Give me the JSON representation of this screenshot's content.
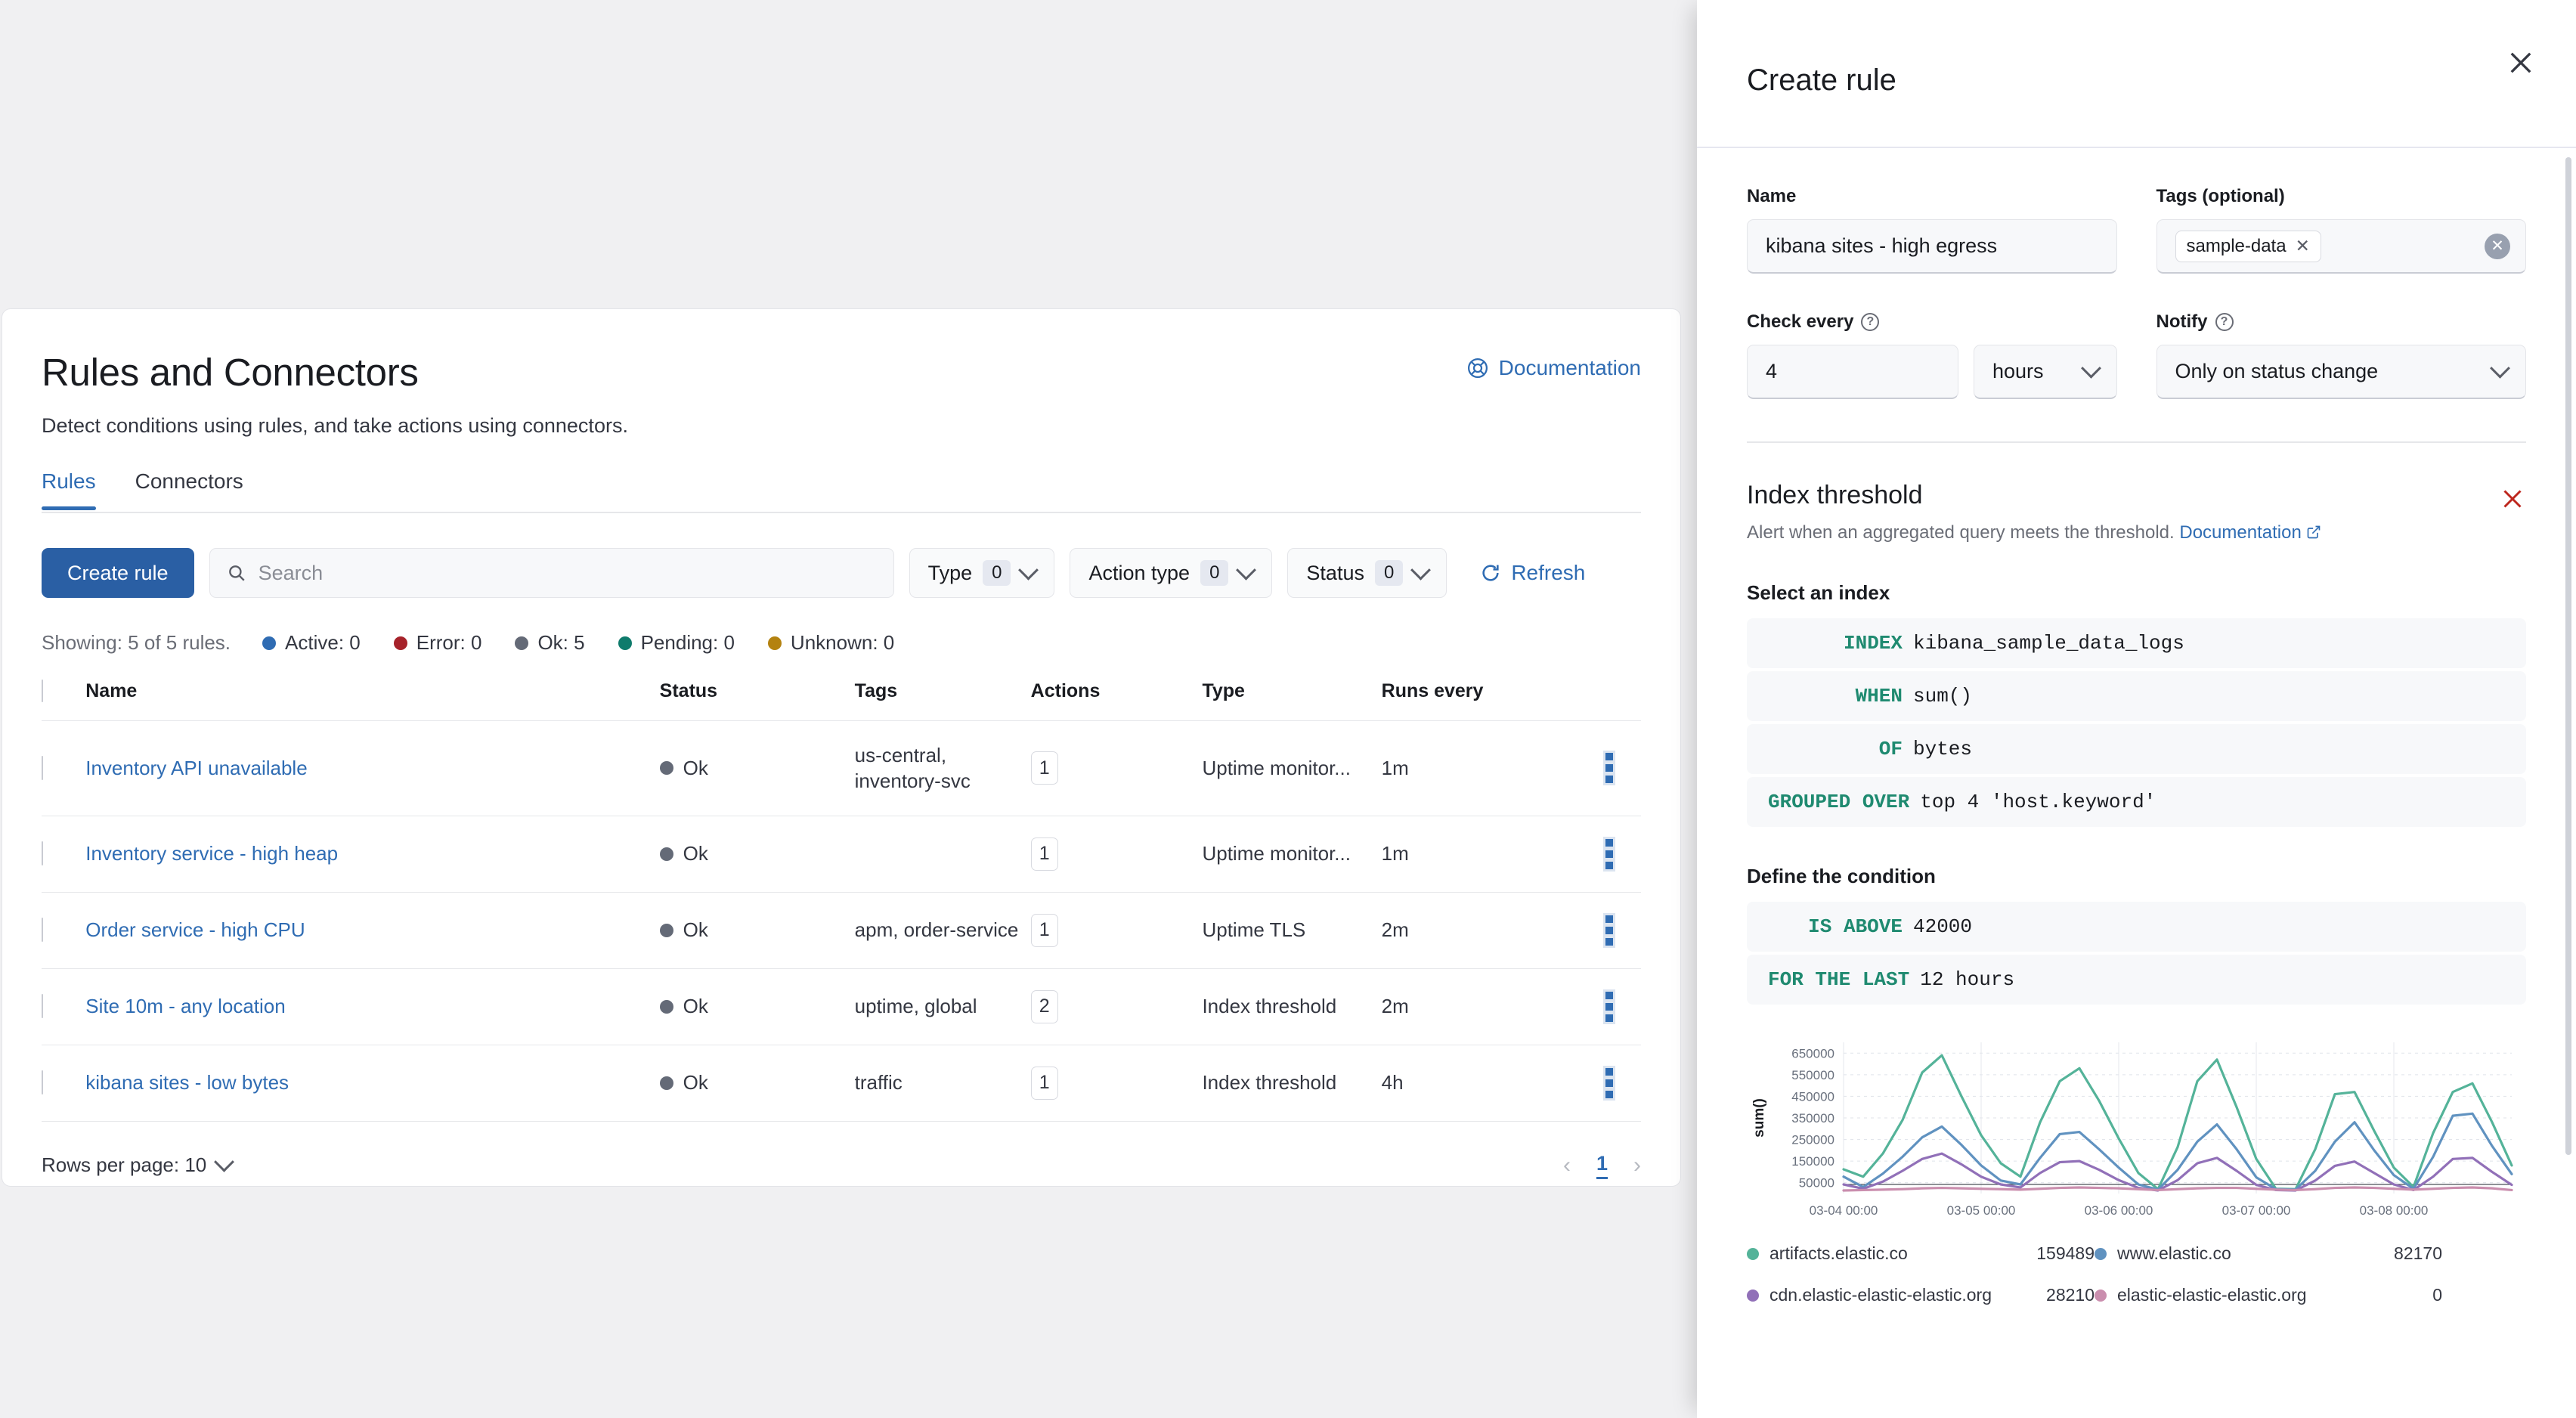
{
  "main": {
    "title": "Rules and Connectors",
    "subtitle": "Detect conditions using rules, and take actions using connectors.",
    "documentation_label": "Documentation",
    "tabs": [
      {
        "label": "Rules",
        "active": true
      },
      {
        "label": "Connectors",
        "active": false
      }
    ],
    "toolbar": {
      "create_rule_label": "Create rule",
      "search_placeholder": "Search",
      "filters": [
        {
          "label": "Type",
          "count": "0"
        },
        {
          "label": "Action type",
          "count": "0"
        },
        {
          "label": "Status",
          "count": "0"
        }
      ],
      "refresh_label": "Refresh"
    },
    "status_line": {
      "showing": "Showing: 5 of 5 rules.",
      "counts": [
        {
          "label": "Active: 0",
          "color": "#2f6cb3"
        },
        {
          "label": "Error: 0",
          "color": "#a6222a"
        },
        {
          "label": "Ok: 5",
          "color": "#646a77"
        },
        {
          "label": "Pending: 0",
          "color": "#0f7b6c"
        },
        {
          "label": "Unknown: 0",
          "color": "#b4820f"
        }
      ]
    },
    "table": {
      "columns": [
        "Name",
        "Status",
        "Tags",
        "Actions",
        "Type",
        "Runs every"
      ],
      "rows": [
        {
          "name": "Inventory API unavailable",
          "status": "Ok",
          "tags": "us-central, inventory-svc",
          "actions": "1",
          "type": "Uptime monitor...",
          "runs_every": "1m"
        },
        {
          "name": "Inventory service - high heap",
          "status": "Ok",
          "tags": "",
          "actions": "1",
          "type": "Uptime monitor...",
          "runs_every": "1m"
        },
        {
          "name": "Order service - high CPU",
          "status": "Ok",
          "tags": "apm, order-service",
          "actions": "1",
          "type": "Uptime TLS",
          "runs_every": "2m"
        },
        {
          "name": "Site 10m - any location",
          "status": "Ok",
          "tags": "uptime, global",
          "actions": "2",
          "type": "Index threshold",
          "runs_every": "2m"
        },
        {
          "name": "kibana sites - low bytes",
          "status": "Ok",
          "tags": "traffic",
          "actions": "1",
          "type": "Index threshold",
          "runs_every": "4h"
        }
      ]
    },
    "footer": {
      "rows_per_page_label": "Rows per page: 10",
      "page_number": "1"
    }
  },
  "flyout": {
    "title": "Create rule",
    "name_label": "Name",
    "name_value": "kibana sites - high egress",
    "tags_label": "Tags (optional)",
    "tags": [
      "sample-data"
    ],
    "check_every_label": "Check every",
    "check_every_value": "4",
    "check_every_unit": "hours",
    "notify_label": "Notify",
    "notify_value": "Only on status change",
    "section": {
      "title": "Index threshold",
      "description": "Alert when an aggregated query meets the threshold.",
      "doc_link": "Documentation"
    },
    "select_index_label": "Select an index",
    "index_expressions": [
      {
        "keyword": "INDEX",
        "value": "kibana_sample_data_logs"
      },
      {
        "keyword": "WHEN",
        "value": "sum()"
      },
      {
        "keyword": "OF",
        "value": "bytes"
      },
      {
        "keyword": "GROUPED OVER",
        "value": "top 4 'host.keyword'"
      }
    ],
    "define_condition_label": "Define the condition",
    "condition_expressions": [
      {
        "keyword": "IS ABOVE",
        "value": "42000"
      },
      {
        "keyword": "FOR THE LAST",
        "value": "12 hours"
      }
    ]
  },
  "chart_data": {
    "type": "line",
    "title": "",
    "xlabel": "",
    "ylabel": "sum()",
    "ylim": [
      0,
      700000
    ],
    "yticks": [
      50000,
      150000,
      250000,
      350000,
      450000,
      550000,
      650000
    ],
    "xticks": [
      "03-04 00:00",
      "03-05 00:00",
      "03-06 00:00",
      "03-07 00:00",
      "03-08 00:00"
    ],
    "grid": true,
    "legend_position": "bottom",
    "threshold": 42000,
    "series": [
      {
        "name": "artifacts.elastic.co",
        "color": "#54b399",
        "total": "159489",
        "values": [
          112000,
          78000,
          185000,
          340000,
          560000,
          640000,
          450000,
          270000,
          140000,
          78000,
          330000,
          520000,
          580000,
          430000,
          255000,
          95000,
          20000,
          215000,
          520000,
          620000,
          400000,
          160000,
          22000,
          20000,
          205000,
          460000,
          470000,
          290000,
          120000,
          30000,
          280000,
          470000,
          510000,
          330000,
          130000
        ]
      },
      {
        "name": "www.elastic.co",
        "color": "#6092c0",
        "total": "82170",
        "values": [
          78000,
          30000,
          92000,
          170000,
          260000,
          310000,
          225000,
          130000,
          60000,
          42000,
          165000,
          275000,
          285000,
          205000,
          120000,
          42000,
          18000,
          110000,
          240000,
          320000,
          205000,
          75000,
          20000,
          18000,
          105000,
          240000,
          330000,
          200000,
          85000,
          22000,
          170000,
          360000,
          370000,
          220000,
          90000
        ]
      },
      {
        "name": "cdn.elastic-elastic-elastic.org",
        "color": "#9170b8",
        "total": "28210",
        "values": [
          42000,
          22000,
          55000,
          105000,
          160000,
          185000,
          135000,
          78000,
          42000,
          28000,
          95000,
          145000,
          150000,
          110000,
          62000,
          26000,
          14000,
          62000,
          140000,
          165000,
          105000,
          40000,
          16000,
          14000,
          60000,
          128000,
          148000,
          95000,
          42000,
          16000,
          78000,
          160000,
          165000,
          100000,
          40000
        ]
      },
      {
        "name": "elastic-elastic-elastic.org",
        "color": "#ca8eae",
        "total": "0",
        "values": [
          14000,
          16000,
          18000,
          20000,
          24000,
          26000,
          24000,
          22000,
          20000,
          18000,
          22000,
          26000,
          28000,
          26000,
          24000,
          20000,
          16000,
          20000,
          24000,
          26000,
          26000,
          22000,
          18000,
          16000,
          20000,
          26000,
          28000,
          26000,
          22000,
          18000,
          22000,
          26000,
          28000,
          24000,
          16000
        ]
      }
    ]
  }
}
